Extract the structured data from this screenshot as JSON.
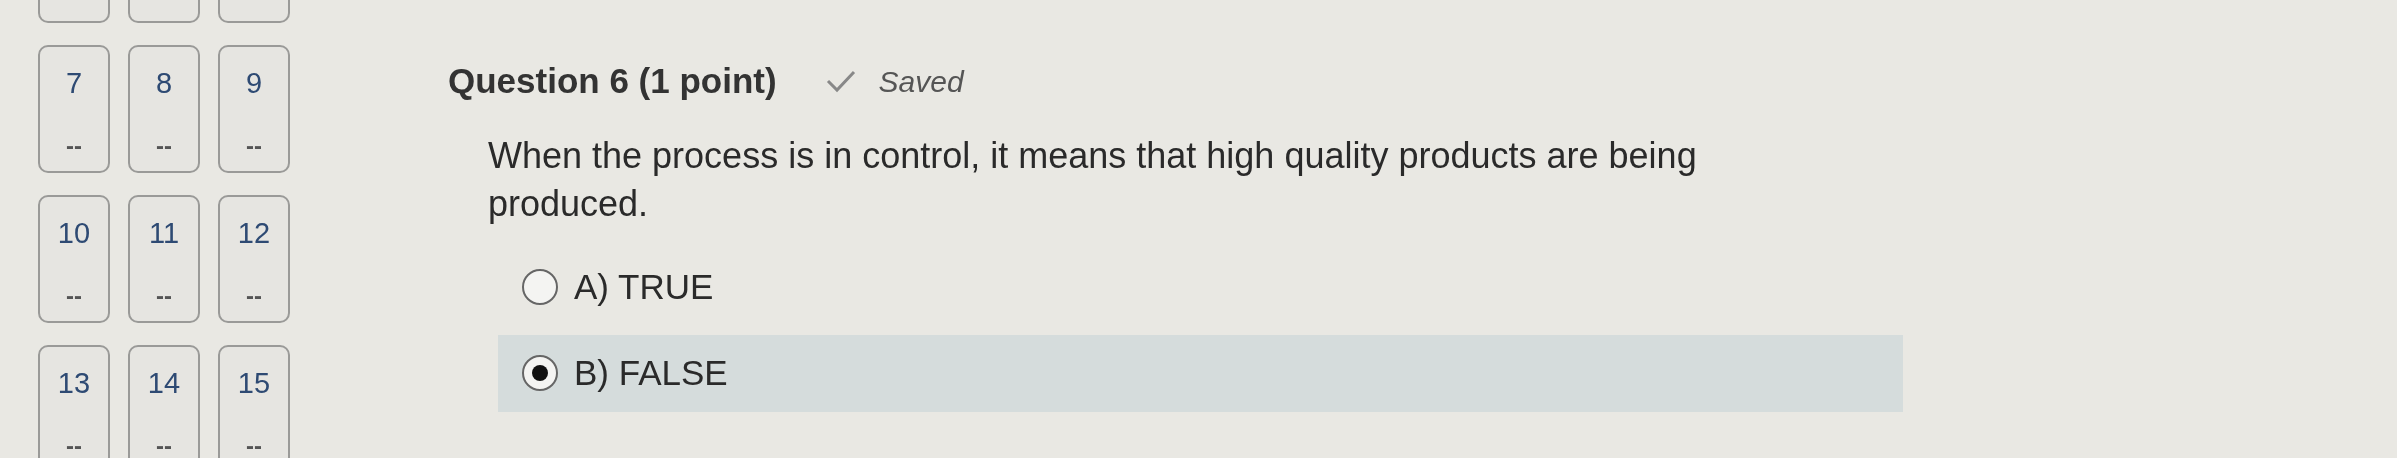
{
  "question_tiles": [
    {
      "cut_off": true
    },
    {
      "cut_off": true
    },
    {
      "cut_off": true
    },
    {
      "number": "7",
      "status": "--"
    },
    {
      "number": "8",
      "status": "--"
    },
    {
      "number": "9",
      "status": "--"
    },
    {
      "number": "10",
      "status": "--"
    },
    {
      "number": "11",
      "status": "--"
    },
    {
      "number": "12",
      "status": "--"
    },
    {
      "number": "13",
      "status": "--"
    },
    {
      "number": "14",
      "status": "--"
    },
    {
      "number": "15",
      "status": "--"
    }
  ],
  "question": {
    "title": "Question 6 (1 point)",
    "saved": "Saved",
    "text": "When the process is in control, it means that high quality products are being produced.",
    "options": [
      {
        "label": "A) TRUE",
        "selected": false
      },
      {
        "label": "B) FALSE",
        "selected": true
      }
    ]
  }
}
